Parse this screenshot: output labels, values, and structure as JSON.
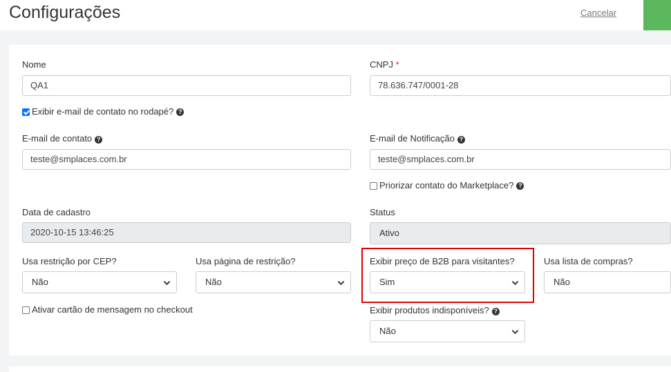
{
  "header": {
    "title": "Configurações",
    "cancel_label": "Cancelar"
  },
  "form": {
    "nome": {
      "label": "Nome",
      "value": "QA1"
    },
    "cnpj": {
      "label": "CNPJ",
      "required_mark": "*",
      "value": "78.636.747/0001-28"
    },
    "show_email_footer": {
      "label": "Exibir e-mail de contato no rodapé?",
      "checked": true
    },
    "contact_email": {
      "label": "E-mail de contato",
      "value": "teste@smplaces.com.br"
    },
    "notification_email": {
      "label": "E-mail de Notificação",
      "value": "teste@smplaces.com.br"
    },
    "prioritize_contact": {
      "label": "Priorizar contato do Marketplace?",
      "checked": false
    },
    "registration_date": {
      "label": "Data de cadastro",
      "value": "2020-10-15 13:46:25"
    },
    "status": {
      "label": "Status",
      "value": "Ativo"
    },
    "cep_restriction": {
      "label": "Usa restrição por CEP?",
      "value": "Não"
    },
    "restriction_page": {
      "label": "Usa página de restrição?",
      "value": "Não"
    },
    "b2b_price_visitors": {
      "label": "Exibir preço de B2B para visitantes?",
      "value": "Sim"
    },
    "shopping_list": {
      "label": "Usa lista de compras?",
      "value": "Não"
    },
    "checkout_message_card": {
      "label": "Ativar cartão de mensagem no checkout",
      "checked": false
    },
    "show_unavailable": {
      "label": "Exibir produtos indisponíveis?",
      "value": "Não"
    }
  },
  "colors": {
    "accent": "#5cb85c",
    "highlight": "#e00000",
    "required": "#d9262c"
  }
}
